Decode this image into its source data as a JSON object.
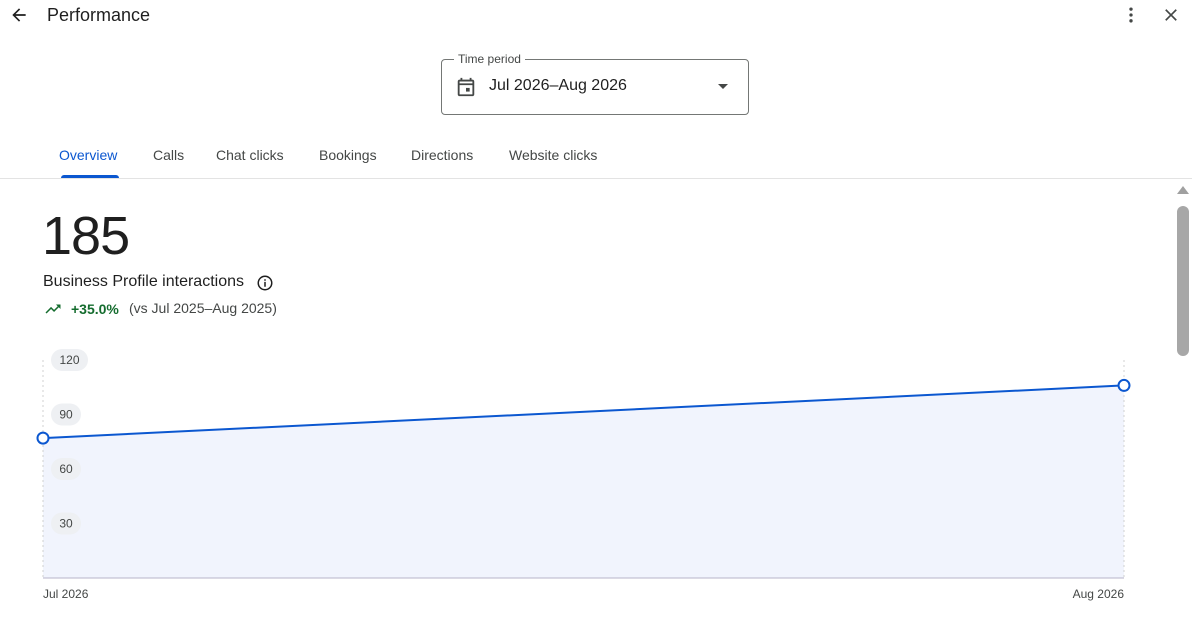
{
  "header": {
    "title": "Performance",
    "back_icon": "arrow-back-icon",
    "more_icon": "more-vert-icon",
    "close_icon": "close-icon"
  },
  "time_period": {
    "label": "Time period",
    "value": "Jul 2026–Aug 2026",
    "icon": "calendar-icon"
  },
  "tabs": [
    {
      "label": "Overview",
      "active": true
    },
    {
      "label": "Calls",
      "active": false
    },
    {
      "label": "Chat clicks",
      "active": false
    },
    {
      "label": "Bookings",
      "active": false
    },
    {
      "label": "Directions",
      "active": false
    },
    {
      "label": "Website clicks",
      "active": false
    }
  ],
  "summary": {
    "total": "185",
    "label": "Business Profile interactions",
    "change": "+35.0%",
    "comparison": "(vs Jul 2025–Aug 2025)"
  },
  "colors": {
    "accent": "#0b57d0",
    "positive": "#146c2e",
    "area_fill": "#f1f4fd"
  },
  "chart_data": {
    "type": "area",
    "x": [
      "Jul 2026",
      "Aug 2026"
    ],
    "series": [
      {
        "values": [
          77,
          106
        ]
      }
    ],
    "y_ticks": [
      "120",
      "90",
      "60",
      "30"
    ],
    "ylim": [
      0,
      120
    ],
    "grid": false
  }
}
